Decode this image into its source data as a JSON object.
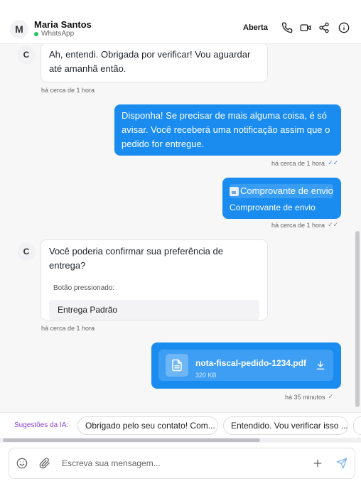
{
  "header": {
    "avatar_initial": "M",
    "contact_name": "Maria Santos",
    "channel": "WhatsApp",
    "status_label": "Aberta",
    "icons": [
      "phone-icon",
      "video-icon",
      "share-icon",
      "info-icon"
    ]
  },
  "messages": [
    {
      "direction": "in",
      "avatar": "C",
      "text": "Ah, entendi. Obrigada por verificar! Vou aguardar até amanhã então.",
      "time": "há cerca de 1 hora"
    },
    {
      "direction": "out",
      "text": "Disponha! Se precisar de mais alguma coisa, é só avisar. Você receberá uma notificação assim que o pedido for entregue.",
      "time": "há cerca de 1 hora",
      "read_status": "read"
    },
    {
      "direction": "out",
      "type": "image",
      "alt": "Comprovante de envio",
      "caption": "Comprovante de envio",
      "time": "há cerca de 1 hora",
      "read_status": "delivered"
    },
    {
      "direction": "in",
      "avatar": "C",
      "text": "Você poderia confirmar sua preferência de entrega?",
      "button_label": "Botão pressionado:",
      "button_value": "Entrega Padrão",
      "time": "há cerca de 1 hora"
    },
    {
      "direction": "out",
      "type": "file",
      "file_name": "nota-fiscal-pedido-1234.pdf",
      "file_size": "320 KB",
      "time": "há 35 minutos",
      "read_status": "delivered"
    }
  ],
  "suggestions": {
    "label": "Sugestões da IA:",
    "items": [
      "Obrigado pelo seu contato! Com...",
      "Entendido. Vou verificar isso ..."
    ]
  },
  "composer": {
    "placeholder": "Escreva sua mensagem..."
  },
  "colors": {
    "outgoing_bubble": "#1a8cf0",
    "online": "#22c55e",
    "suggestion_label": "#8b3fd6"
  }
}
